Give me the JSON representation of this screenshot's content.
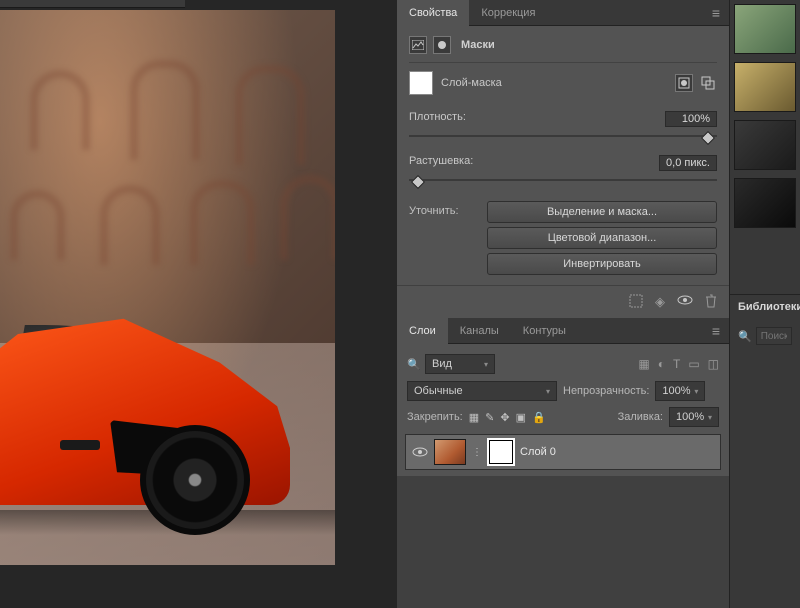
{
  "properties": {
    "tabs": {
      "properties": "Свойства",
      "adjustments": "Коррекция"
    },
    "masks_label": "Маски",
    "mask_type_label": "Слой-маска",
    "density_label": "Плотность:",
    "density_value": "100%",
    "feather_label": "Растушевка:",
    "feather_value": "0,0 пикс.",
    "refine_label": "Уточнить:",
    "buttons": {
      "select_and_mask": "Выделение и маска...",
      "color_range": "Цветовой диапазон...",
      "invert": "Инвертировать"
    }
  },
  "layers": {
    "tabs": {
      "layers": "Слои",
      "channels": "Каналы",
      "paths": "Контуры"
    },
    "filter_dropdown": "Вид",
    "blend_mode": "Обычные",
    "opacity_label": "Непрозрачность:",
    "opacity_value": "100%",
    "lock_label": "Закрепить:",
    "fill_label": "Заливка:",
    "fill_value": "100%",
    "items": [
      {
        "name": "Слой 0"
      }
    ]
  },
  "libraries": {
    "title": "Библиотеки",
    "search_placeholder": "Поиск в..."
  }
}
